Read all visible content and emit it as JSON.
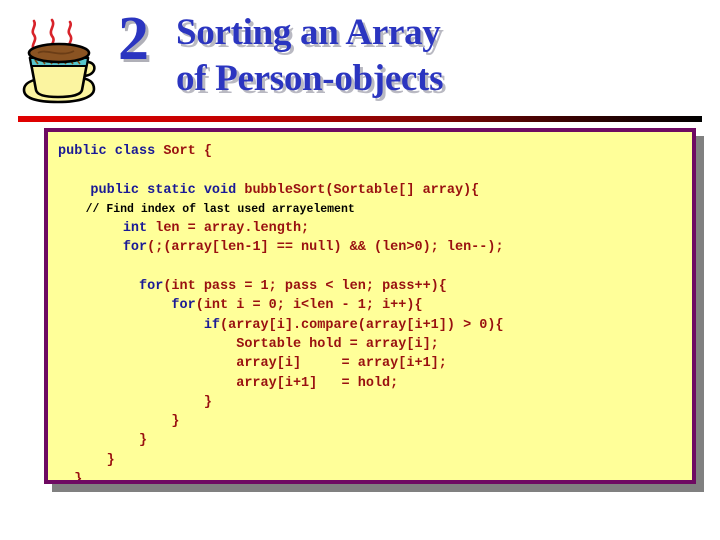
{
  "slide": {
    "bullet_number": "2",
    "title_lines": [
      "Sorting an Array",
      "of Person-objects"
    ],
    "icon": "coffee-cup-icon",
    "colors": {
      "title_text": "#2b35c0",
      "title_shadow": "#b9b9c2",
      "rule_start": "#e00000",
      "rule_end": "#000000",
      "code_background": "#ffff99",
      "code_border": "#6e0a62",
      "code_shadow": "#808080",
      "keyword": "#1a1a96",
      "plain_code": "#991010",
      "comment": "#000000"
    }
  },
  "code": {
    "language": "java",
    "lines": [
      {
        "indent": 0,
        "type": "code",
        "segments": [
          {
            "t": "public class ",
            "c": "kw"
          },
          {
            "t": "Sort {",
            "c": "pl"
          }
        ]
      },
      {
        "indent": 0,
        "type": "blank",
        "segments": []
      },
      {
        "indent": 2,
        "type": "code",
        "segments": [
          {
            "t": "public static void ",
            "c": "kw"
          },
          {
            "t": "bubbleSort(Sortable[] array){",
            "c": "pl"
          }
        ]
      },
      {
        "indent": 2,
        "type": "comment",
        "segments": [
          {
            "t": "// Find index of last used arrayelement",
            "c": "cm"
          }
        ]
      },
      {
        "indent": 4,
        "type": "code",
        "segments": [
          {
            "t": "int ",
            "c": "kw"
          },
          {
            "t": "len = array.length;",
            "c": "pl"
          }
        ]
      },
      {
        "indent": 4,
        "type": "code",
        "segments": [
          {
            "t": "for",
            "c": "kw"
          },
          {
            "t": "(;(array[len-1] == null) && (len>0); len--);",
            "c": "pl"
          }
        ]
      },
      {
        "indent": 0,
        "type": "blank",
        "segments": []
      },
      {
        "indent": 5,
        "type": "code",
        "segments": [
          {
            "t": "for",
            "c": "kw"
          },
          {
            "t": "(int pass = 1; pass < len; pass++){",
            "c": "pl"
          }
        ]
      },
      {
        "indent": 7,
        "type": "code",
        "segments": [
          {
            "t": "for",
            "c": "kw"
          },
          {
            "t": "(int i = 0; i<len - 1; i++){",
            "c": "pl"
          }
        ]
      },
      {
        "indent": 9,
        "type": "code",
        "segments": [
          {
            "t": "if",
            "c": "kw"
          },
          {
            "t": "(array[i].compare(array[i+1]) > 0){",
            "c": "pl"
          }
        ]
      },
      {
        "indent": 11,
        "type": "code",
        "segments": [
          {
            "t": "Sortable hold = array[i];",
            "c": "pl"
          }
        ]
      },
      {
        "indent": 11,
        "type": "code",
        "segments": [
          {
            "t": "array[i]     = array[i+1];",
            "c": "pl"
          }
        ]
      },
      {
        "indent": 11,
        "type": "code",
        "segments": [
          {
            "t": "array[i+1]   = hold;",
            "c": "pl"
          }
        ]
      },
      {
        "indent": 9,
        "type": "code",
        "segments": [
          {
            "t": "}",
            "c": "pl"
          }
        ]
      },
      {
        "indent": 7,
        "type": "code",
        "segments": [
          {
            "t": "}",
            "c": "pl"
          }
        ]
      },
      {
        "indent": 5,
        "type": "code",
        "segments": [
          {
            "t": "}",
            "c": "pl"
          }
        ]
      },
      {
        "indent": 3,
        "type": "code",
        "segments": [
          {
            "t": "}",
            "c": "pl"
          }
        ]
      },
      {
        "indent": 1,
        "type": "code",
        "segments": [
          {
            "t": "}",
            "c": "pl"
          }
        ]
      }
    ]
  }
}
